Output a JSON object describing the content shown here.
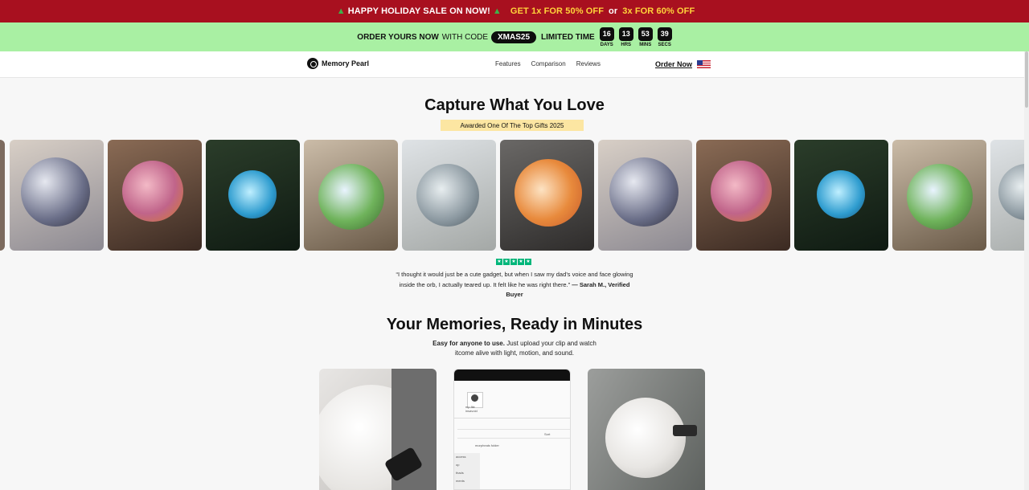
{
  "sale_bar": {
    "tree_icon": "tree-icon",
    "headline": "HAPPY HOLIDAY SALE ON NOW!",
    "offer1": "GET 1x FOR 50% OFF",
    "or": "or",
    "offer2": "3x FOR 60% OFF",
    "colors": {
      "background": "#a8101f",
      "offer": "#ffd43b"
    }
  },
  "code_bar": {
    "prefix": "ORDER YOURS NOW",
    "with_code": "WITH CODE",
    "code": "XMAS25",
    "limited": "LIMITED TIME",
    "timer": [
      {
        "value": "16",
        "label": "DAYS"
      },
      {
        "value": "13",
        "label": "HRS"
      },
      {
        "value": "53",
        "label": "MINS"
      },
      {
        "value": "39",
        "label": "SECS"
      }
    ],
    "colors": {
      "background": "#a9f0a3"
    }
  },
  "nav": {
    "brand": "Memory Pearl",
    "links": [
      "Features",
      "Comparison",
      "Reviews"
    ],
    "order": "Order Now",
    "flag_icon": "us-flag-icon"
  },
  "hero": {
    "title": "Capture What You Love",
    "award": "Awarded One Of The Top Gifts 2025"
  },
  "review": {
    "stars": 5,
    "quote": "“I thought it would just be a cute gadget, but when I saw my dad’s voice and face glowing inside the orb, I actually teared up. It felt like he was right there.”",
    "author": "— Sarah M., Verified Buyer"
  },
  "memories": {
    "title": "Your Memories, Ready in Minutes",
    "sub_bold": "Easy for anyone to use.",
    "sub_line1": "Just upload your clip and watch",
    "sub_line2": "itcome alive with light, motion, and sound."
  },
  "card2": {
    "file_label": "mp file",
    "file_label2": "insavoid",
    "folder": "morpheals folder",
    "sort": "Sort",
    "rows": [
      "access",
      "op",
      "thads",
      "ments"
    ]
  }
}
